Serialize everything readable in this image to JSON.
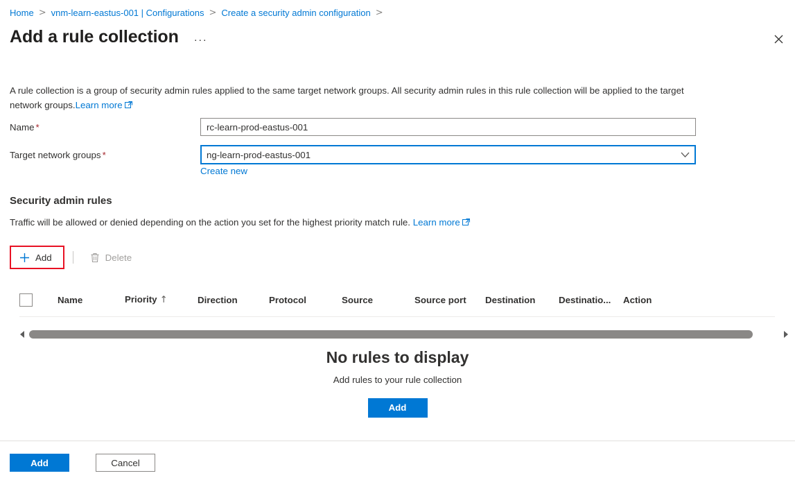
{
  "breadcrumb": {
    "items": [
      {
        "label": "Home"
      },
      {
        "label": "vnm-learn-eastus-001 | Configurations"
      },
      {
        "label": "Create a security admin configuration"
      }
    ],
    "separator": ">"
  },
  "header": {
    "title": "Add a rule collection",
    "overflow_label": "···",
    "close_label": "✕"
  },
  "description": {
    "text": "A rule collection is a group of security admin rules applied to the same target network groups. All security admin rules in this rule collection will be applied to the target network groups.",
    "learn_more": "Learn more"
  },
  "form": {
    "name": {
      "label": "Name",
      "required_marker": "*",
      "value": "rc-learn-prod-eastus-001",
      "placeholder": ""
    },
    "target_network_groups": {
      "label": "Target network groups",
      "required_marker": "*",
      "value": "ng-learn-prod-eastus-001",
      "chevron": "∨",
      "create_new_label": "Create new"
    }
  },
  "security_admin_rules": {
    "section_title": "Security admin rules",
    "section_subtitle": "Traffic will be allowed or denied depending on the action you set for the highest priority match rule.",
    "learn_more": "Learn more",
    "commands": {
      "add": {
        "label": "Add",
        "icon": "plus-icon",
        "highlighted": true
      },
      "delete": {
        "label": "Delete",
        "icon": "trash-icon",
        "disabled": true
      }
    },
    "table": {
      "columns": [
        {
          "label": "Name",
          "sort": ""
        },
        {
          "label": "Priority",
          "sort": "↑"
        },
        {
          "label": "Direction",
          "sort": ""
        },
        {
          "label": "Protocol",
          "sort": ""
        },
        {
          "label": "Source",
          "sort": ""
        },
        {
          "label": "Source port",
          "sort": ""
        },
        {
          "label": "Destination",
          "sort": ""
        },
        {
          "label": "Destinatio...",
          "sort": ""
        },
        {
          "label": "Action",
          "sort": ""
        }
      ],
      "rows": []
    },
    "empty_state": {
      "title": "No rules to display",
      "subtitle": "Add rules to your rule collection",
      "button_label": "Add"
    }
  },
  "footer": {
    "primary_label": "Add",
    "secondary_label": "Cancel"
  },
  "colors": {
    "accent": "#0078d4",
    "link": "#0078d4",
    "required": "#a4262c",
    "highlight": "#e81123",
    "disabled_text": "#a19f9d",
    "scrollbar_thumb": "#8a8886"
  }
}
